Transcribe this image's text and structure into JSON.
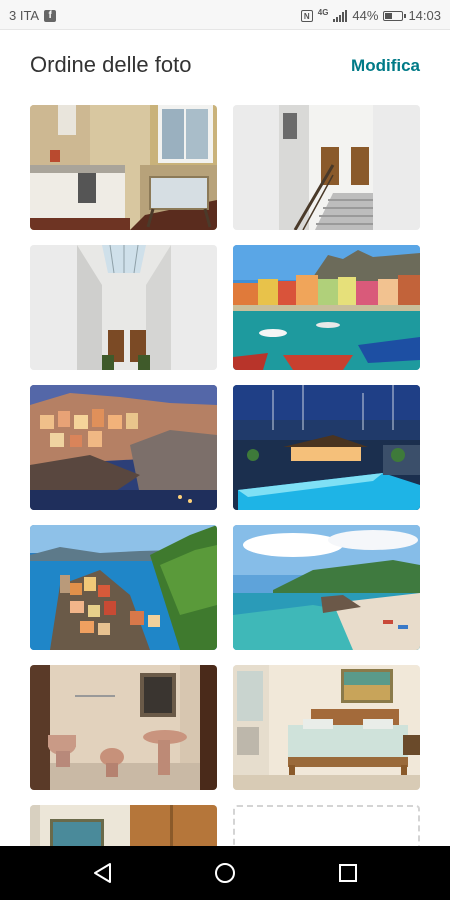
{
  "status_bar": {
    "carrier": "3 ITA",
    "network": "4G",
    "battery": "44%",
    "battery_level": 0.44,
    "time": "14:03",
    "icons": [
      "facebook-icon",
      "nfc-icon",
      "signal-icon",
      "battery-icon"
    ]
  },
  "header": {
    "title": "Ordine delle foto",
    "action_label": "Modifica",
    "accent_color": "#007a87"
  },
  "photos": [
    {
      "kind": "kitchen"
    },
    {
      "kind": "stairs"
    },
    {
      "kind": "skylight"
    },
    {
      "kind": "harbor-village"
    },
    {
      "kind": "cliff-village-night"
    },
    {
      "kind": "marina-pool"
    },
    {
      "kind": "coastal-village"
    },
    {
      "kind": "beach-bay"
    },
    {
      "kind": "bathroom"
    },
    {
      "kind": "bedroom"
    },
    {
      "kind": "room"
    },
    {
      "kind": "add-photo"
    }
  ],
  "nav_bar": {
    "buttons": [
      "back-icon",
      "home-icon",
      "recents-icon"
    ]
  }
}
